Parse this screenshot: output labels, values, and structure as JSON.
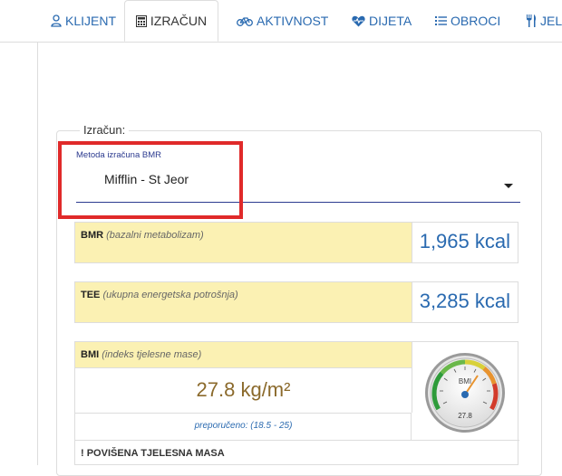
{
  "tabs": [
    {
      "label": "KLIJENT",
      "icon": "user-icon"
    },
    {
      "label": "IZRAČUN",
      "icon": "calculator-icon"
    },
    {
      "label": "AKTIVNOST",
      "icon": "bicycle-icon"
    },
    {
      "label": "DIJETA",
      "icon": "heartbeat-icon"
    },
    {
      "label": "OBROCI",
      "icon": "list-icon"
    },
    {
      "label": "JELO",
      "icon": "utensils-icon"
    }
  ],
  "fieldset": {
    "legend": "Izračun:"
  },
  "bmr_method": {
    "label": "Metoda izračuna BMR",
    "value": "Mifflin - St Jeor"
  },
  "bmr": {
    "title": "BMR",
    "subtitle": "(bazalni metabolizam)",
    "value": "1,965 kcal"
  },
  "tee": {
    "title": "TEE",
    "subtitle": "(ukupna energetska potrošnja)",
    "value": "3,285 kcal"
  },
  "bmi": {
    "title": "BMI",
    "subtitle": "(indeks tjelesne mase)",
    "value": "27.8 kg/m²",
    "recommended": "preporučeno: (18.5 - 25)",
    "warning": "! POVIŠENA TJELESNA MASA",
    "gauge_label": "BMI",
    "gauge_value": "27.8"
  },
  "colors": {
    "accent": "#2a6ab0",
    "highlight": "#e02a2a",
    "label_bg": "#fbf1b3"
  }
}
